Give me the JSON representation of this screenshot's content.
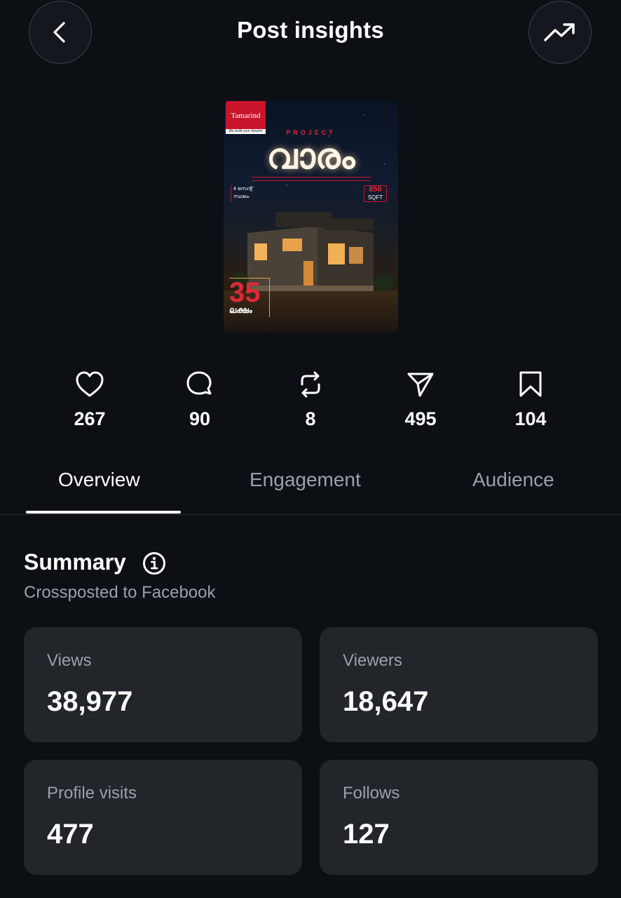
{
  "header": {
    "title": "Post insights",
    "back_icon": "chevron-left-icon",
    "trend_icon": "trending-up-icon"
  },
  "post": {
    "logo_text": "Tamarind",
    "logo_subtext": "We build your dreams",
    "project_label": "PROJECT",
    "title_text": "വാരം",
    "left_note": "4 സെന്റ് സ്ഥലം",
    "sqft_value": "850",
    "sqft_unit": "SQFT",
    "price_number": "35",
    "price_word": "ലക്ഷം"
  },
  "stats": [
    {
      "icon": "heart-icon",
      "value": "267"
    },
    {
      "icon": "comment-icon",
      "value": "90"
    },
    {
      "icon": "repost-icon",
      "value": "8"
    },
    {
      "icon": "share-icon",
      "value": "495"
    },
    {
      "icon": "bookmark-icon",
      "value": "104"
    }
  ],
  "tabs": [
    {
      "label": "Overview",
      "active": true
    },
    {
      "label": "Engagement",
      "active": false
    },
    {
      "label": "Audience",
      "active": false
    }
  ],
  "summary": {
    "title": "Summary",
    "subtitle": "Crossposted to Facebook",
    "cards": [
      {
        "label": "Views",
        "value": "38,977"
      },
      {
        "label": "Viewers",
        "value": "18,647"
      },
      {
        "label": "Profile visits",
        "value": "477"
      },
      {
        "label": "Follows",
        "value": "127"
      }
    ]
  },
  "colors": {
    "background": "#0c0f14",
    "card": "#22252a",
    "muted_text": "#9aa1ab",
    "accent_red": "#c8152b"
  }
}
